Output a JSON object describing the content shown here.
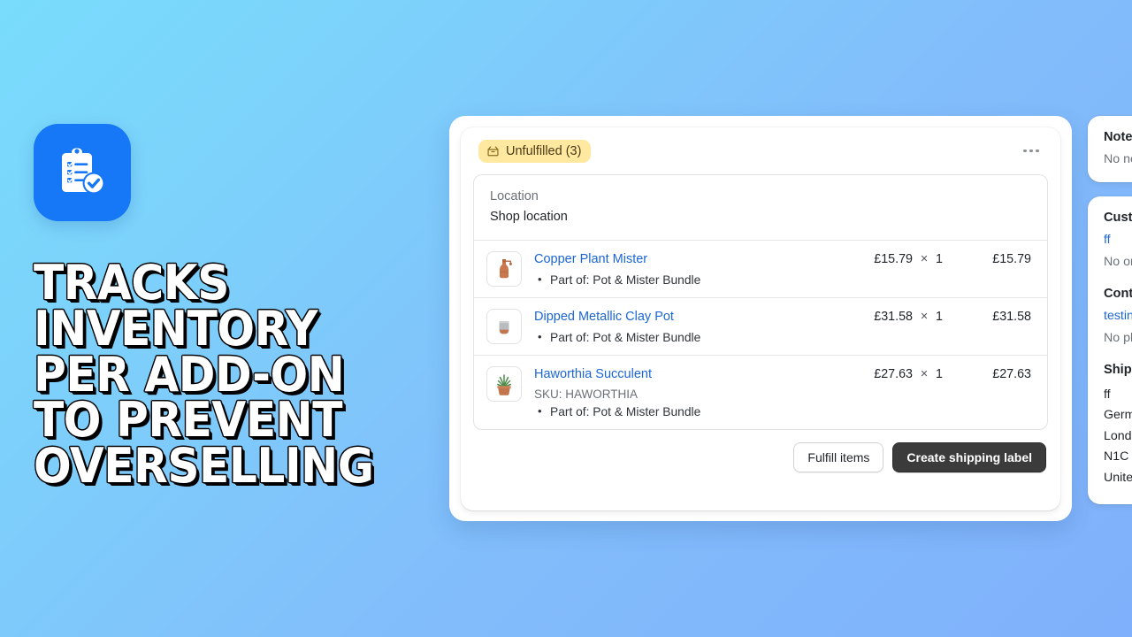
{
  "promo": {
    "app_icon": "clipboard-check-icon",
    "headline_lines": [
      "TRACKS",
      "INVENTORY",
      "PER ADD-ON",
      "TO PREVENT",
      "OVERSELLING"
    ]
  },
  "colors": {
    "background_start": "#79dcfc",
    "background_end": "#7fb0fb",
    "app_icon_blue": "#1677f7",
    "badge_yellow": "#ffe9a0",
    "link_blue": "#1b66d6",
    "primary_button": "#3b3b3b"
  },
  "fulfillment_card": {
    "status_badge": {
      "icon": "package-icon",
      "label": "Unfulfilled (3)"
    },
    "overflow_menu": "more-actions",
    "location": {
      "label": "Location",
      "value": "Shop location"
    },
    "items": [
      {
        "thumb": "copper-mister-icon",
        "title": "Copper Plant Mister",
        "sku": "",
        "note": "Part of: Pot & Mister Bundle",
        "unit_price": "£15.79",
        "times": "×",
        "quantity": "1",
        "line_total": "£15.79"
      },
      {
        "thumb": "clay-pot-icon",
        "title": "Dipped Metallic Clay Pot",
        "sku": "",
        "note": "Part of: Pot & Mister Bundle",
        "unit_price": "£31.58",
        "times": "×",
        "quantity": "1",
        "line_total": "£31.58"
      },
      {
        "thumb": "succulent-icon",
        "title": "Haworthia Succulent",
        "sku": "SKU: HAWORTHIA",
        "note": "Part of: Pot & Mister Bundle",
        "unit_price": "£27.63",
        "times": "×",
        "quantity": "1",
        "line_total": "£27.63"
      }
    ],
    "actions": {
      "secondary": "Fulfill items",
      "primary": "Create shipping label"
    }
  },
  "side_column": {
    "notes_card": {
      "heading": "Notes",
      "body": "No notes"
    },
    "customer_card": {
      "customer_heading": "Customer",
      "customer_name": "ff",
      "order_count": "No orders",
      "contact_heading": "Contact information",
      "contact_email": "testing@example.com",
      "phone": "No phone number",
      "shipping_heading": "Shipping address",
      "address_lines": [
        "ff",
        "German Street",
        "London",
        "N1C",
        "United Kingdom"
      ]
    }
  }
}
